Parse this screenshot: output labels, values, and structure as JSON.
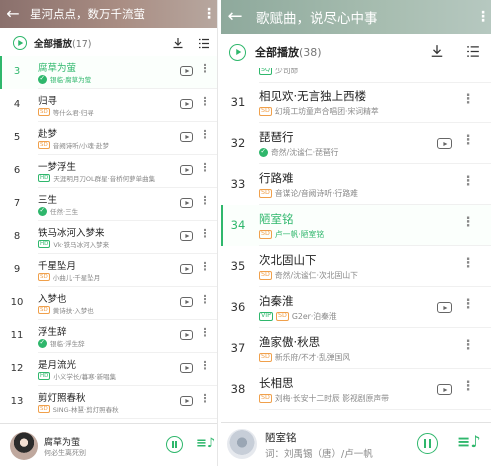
{
  "colors": {
    "accent": "#2fb76c",
    "sd_badge": "#f0a04b"
  },
  "left": {
    "header": {
      "back_icon": "arrow-left-icon",
      "title": "星河点点，数万千流萤",
      "menu": "⋮"
    },
    "playall": {
      "label": "全部播放",
      "count": "(17)",
      "download_icon": "download-icon",
      "multiselect_icon": "list-select-icon"
    },
    "rows": [
      {
        "num": "3",
        "title": "腐草为萤",
        "badge": "ok",
        "sub": "银临·腐草为萤",
        "current": true
      },
      {
        "num": "4",
        "title": "归寻",
        "badge": "SD",
        "sub": "等什么君·归寻"
      },
      {
        "num": "5",
        "title": "赴梦",
        "badge": "SD",
        "sub": "音阙诗听/小魂·赴梦"
      },
      {
        "num": "6",
        "title": "一梦浮生",
        "badge": "HD",
        "sub": "天涯明月刀OL群星·音桥何萝单曲集"
      },
      {
        "num": "7",
        "title": "三生",
        "badge": "ok",
        "sub": "任然·三生"
      },
      {
        "num": "8",
        "title": "铁马冰河入梦来",
        "badge": "HD",
        "sub": "Vk·铁马冰河入梦来"
      },
      {
        "num": "9",
        "title": "千星坠月",
        "badge": "SD",
        "sub": "小曲儿·千星坠月"
      },
      {
        "num": "10",
        "title": "入梦也",
        "badge": "SD",
        "sub": "黄诗扶·入梦也"
      },
      {
        "num": "11",
        "title": "浮生辞",
        "badge": "ok",
        "sub": "银临·浮生辞"
      },
      {
        "num": "12",
        "title": "是月流光",
        "badge": "HD",
        "sub": "小义学长/暮寒·新唱集"
      },
      {
        "num": "13",
        "title": "剪灯照春秋",
        "badge": "SD",
        "sub": "SING-林慧·剪灯照春秋"
      }
    ],
    "player": {
      "title": "腐草为萤",
      "sub": "何必生离死别",
      "pause_icon": "pause-icon",
      "queue_icon": "playlist-icon",
      "queue_glyph": "≡♪"
    }
  },
  "right": {
    "header": {
      "back_icon": "arrow-left-icon",
      "title": "歌赋曲，说尽心中事",
      "menu": "⋮"
    },
    "playall": {
      "label": "全部播放",
      "count": "(38)",
      "download_icon": "download-icon",
      "multiselect_icon": "list-select-icon"
    },
    "partial_row": {
      "num": "30",
      "badge": "SQ",
      "sub": "少司命"
    },
    "rows": [
      {
        "num": "31",
        "title": "相见欢·无言独上西楼",
        "badge": "SD",
        "sub": "幻境工坊童声合唱团·宋词精萃",
        "mv": false
      },
      {
        "num": "32",
        "title": "琵琶行",
        "badge": "ok",
        "sub": "奇然/沈谧仁·琵琶行",
        "mv": true
      },
      {
        "num": "33",
        "title": "行路难",
        "badge": "SD",
        "sub": "音谋论/音阙诗听·行路难",
        "mv": false
      },
      {
        "num": "34",
        "title": "陋室铭",
        "badge": "SD",
        "sub": "卢一帆·陋室铭",
        "mv": false,
        "current": true
      },
      {
        "num": "35",
        "title": "次北固山下",
        "badge": "SD",
        "sub": "奇然/沈谧仁·次北固山下",
        "mv": false
      },
      {
        "num": "36",
        "title": "泊秦淮",
        "badge": "VIP",
        "badge2": "SD",
        "sub": "G2er·泊秦淮",
        "mv": true
      },
      {
        "num": "37",
        "title": "渔家傲·秋思",
        "badge": "SD",
        "sub": "新乐府/不才·乱弹国风",
        "mv": false
      },
      {
        "num": "38",
        "title": "长相思",
        "badge": "SD",
        "sub": "刘梅·长安十二时辰 影视剧原声带",
        "mv": true
      }
    ],
    "player": {
      "title": "陋室铭",
      "sub": "词：刘禹锡（唐）/卢一帆",
      "pause_icon": "pause-icon",
      "queue_icon": "playlist-icon",
      "queue_glyph": "≡♪"
    }
  }
}
